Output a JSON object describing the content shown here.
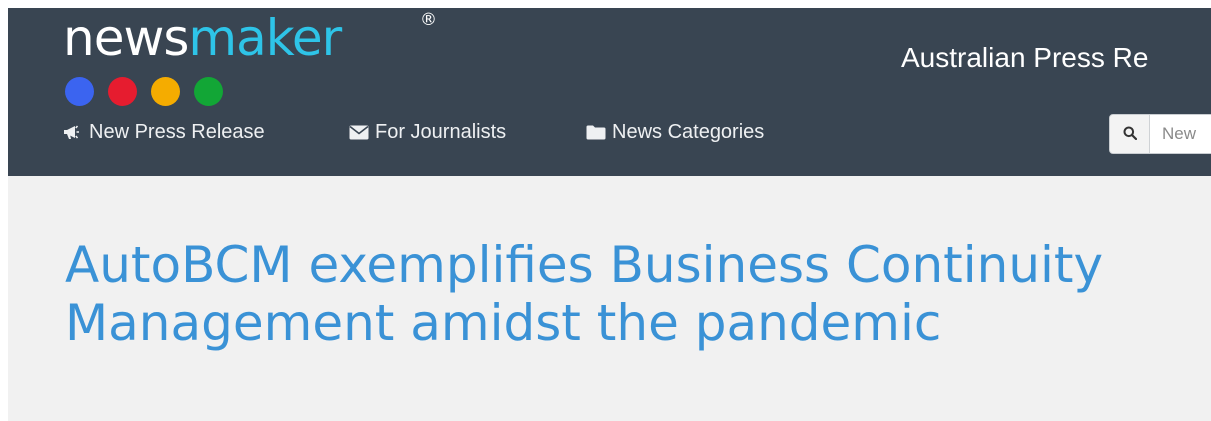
{
  "header": {
    "logo": {
      "part1": "news",
      "part2": "maker",
      "registered": "®",
      "dot_colors": [
        "#3b64f0",
        "#e61c2f",
        "#f5ac00",
        "#12a636"
      ]
    },
    "site_title": "Australian Press Re",
    "nav": [
      {
        "label": "New Press Release",
        "icon": "megaphone-icon"
      },
      {
        "label": "For Journalists",
        "icon": "envelope-icon"
      },
      {
        "label": "News Categories",
        "icon": "folder-icon"
      }
    ],
    "search": {
      "placeholder": "New",
      "icon": "search-icon"
    }
  },
  "article": {
    "headline_line1": "AutoBCM exemplifies Business Continuity",
    "headline_line2": "Management amidst the pandemic"
  },
  "colors": {
    "header_bg": "#394552",
    "logo_accent": "#2ec4e8",
    "headline": "#3a92d6",
    "page_bg": "#f1f1f1"
  }
}
